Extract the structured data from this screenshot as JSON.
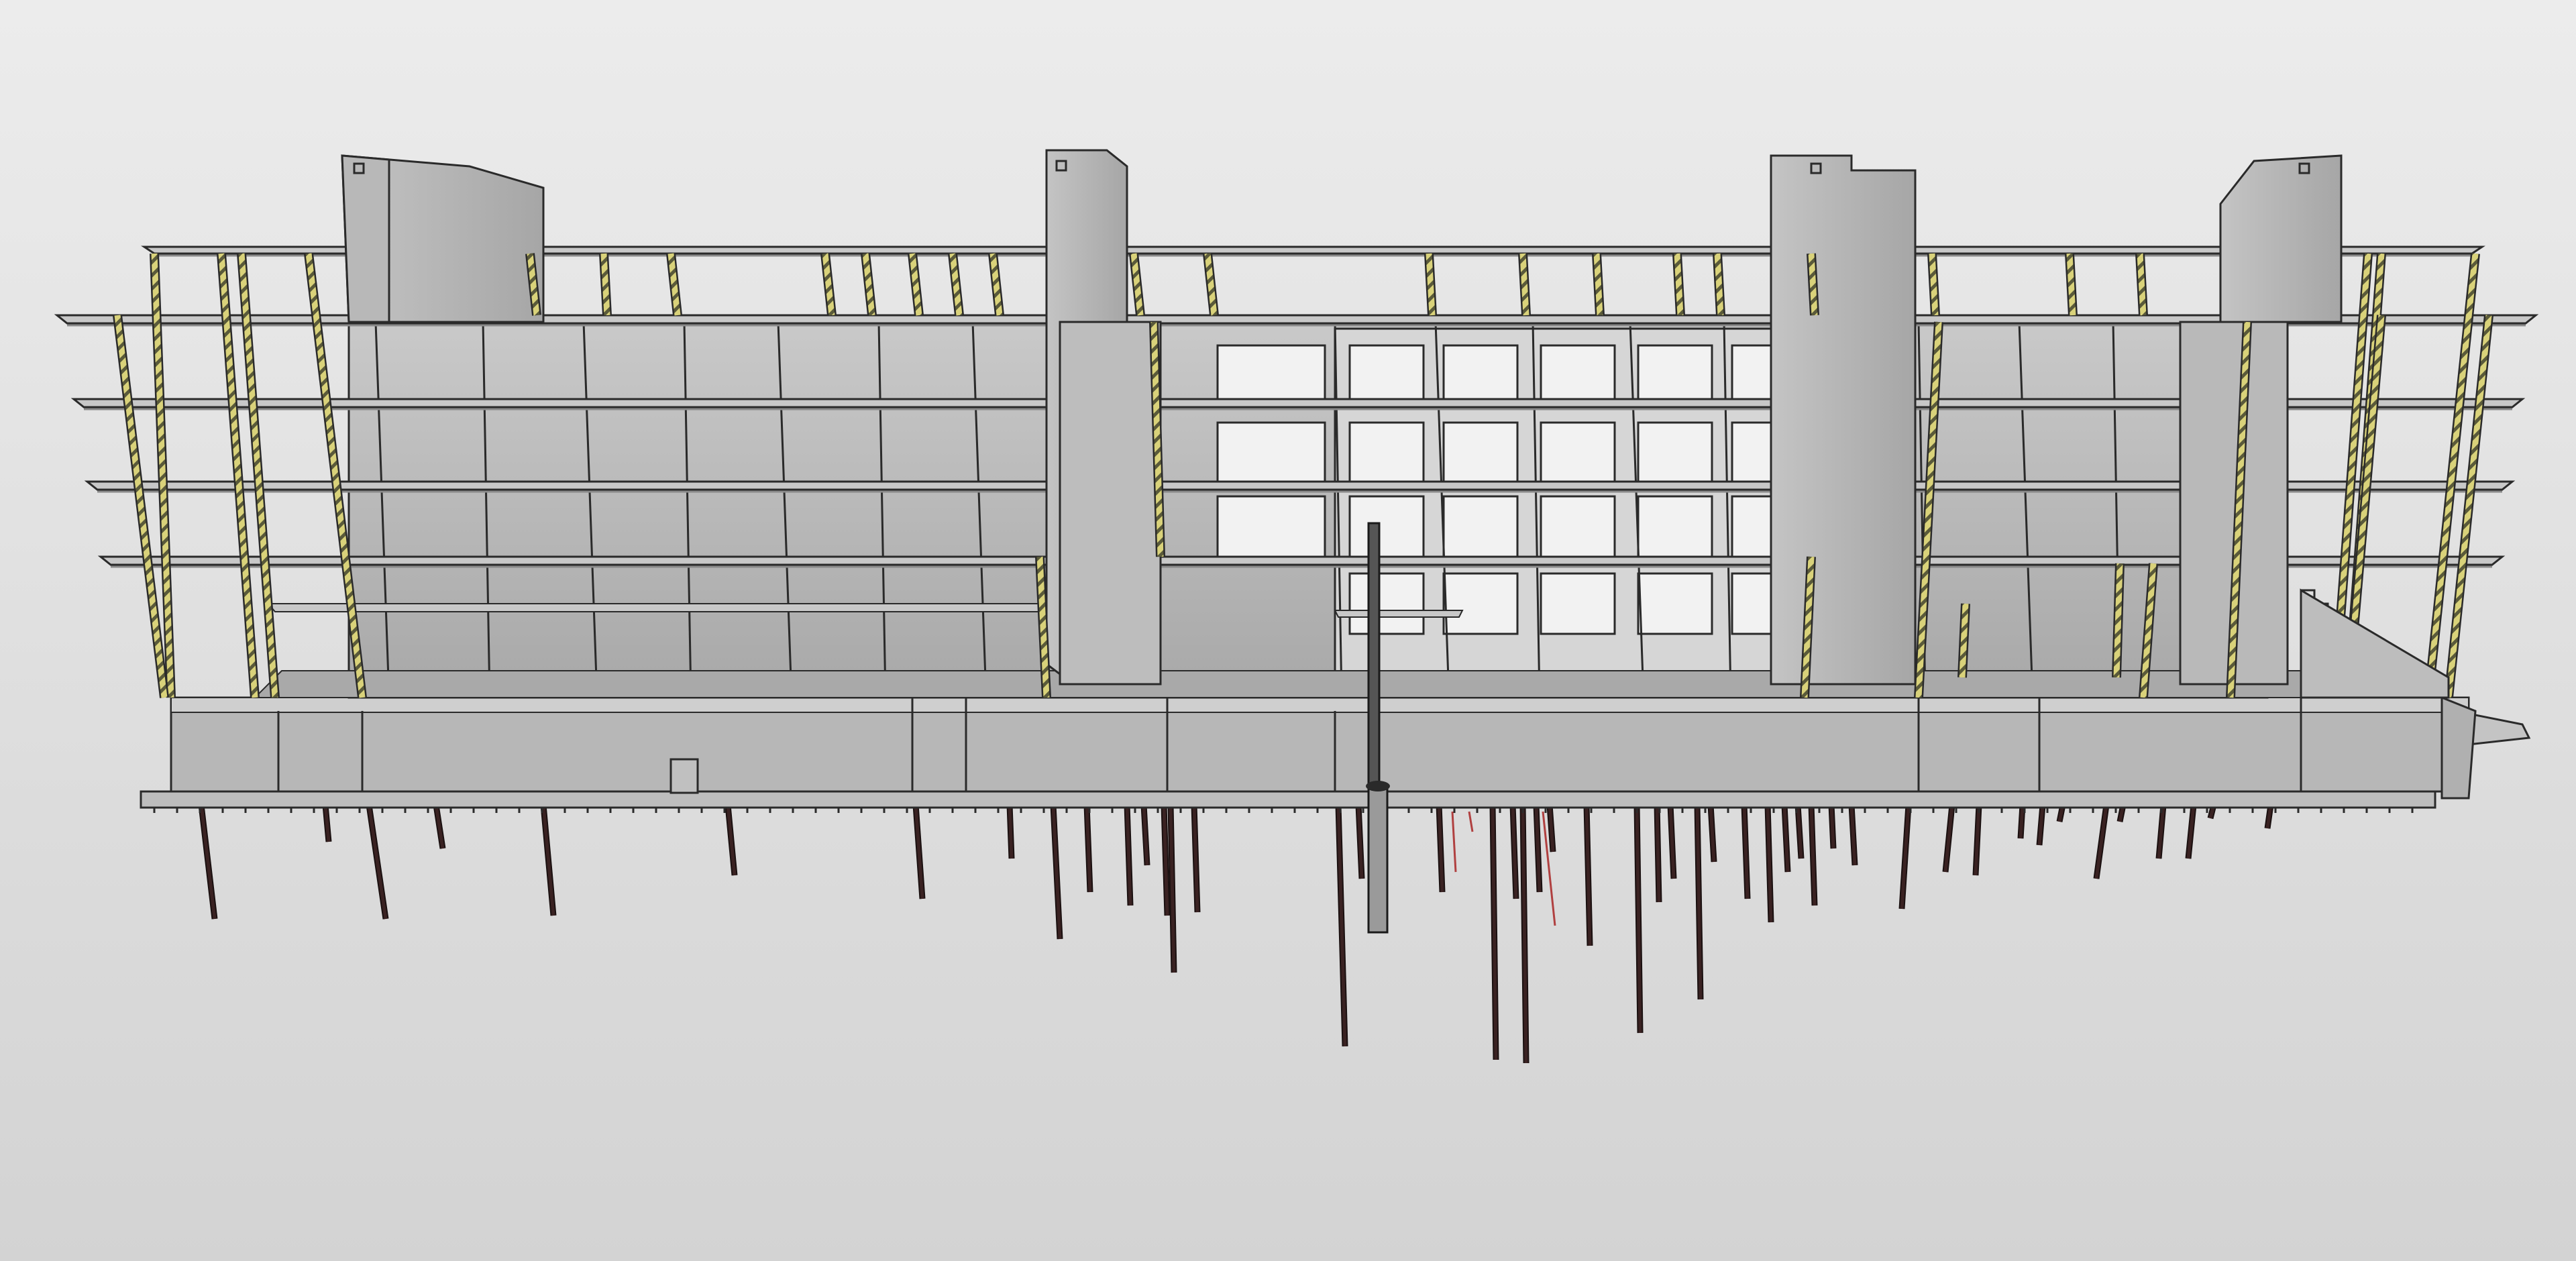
{
  "viewport": {
    "background_top": "#ececec",
    "background_bottom": "#d3d3d3"
  },
  "model": {
    "element_colors": {
      "concrete_light": "#c8c8c8",
      "concrete_mid": "#b2b2b2",
      "concrete_dark": "#9a9a9a",
      "slab_edge": "#8a8a8a",
      "edge_line": "#2a2a2a",
      "steel_column": "#d9d27a",
      "steel_stripe": "#5a5a3a",
      "pile": "#3a2222",
      "pile_highlight": "#b04040",
      "mast": "#555555"
    }
  }
}
